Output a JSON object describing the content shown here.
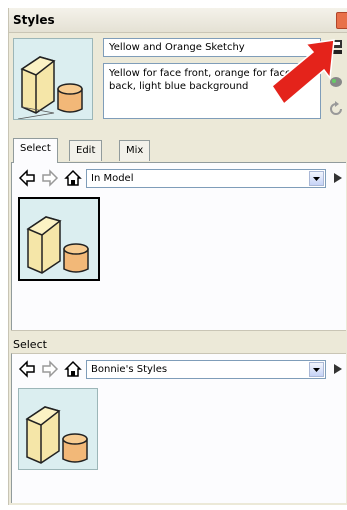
{
  "window": {
    "title": "Styles"
  },
  "current_style": {
    "name": "Yellow and Orange Sketchy",
    "description": "Yellow for face front, orange for face back, light blue background"
  },
  "tabs": [
    {
      "label": "Select",
      "active": true
    },
    {
      "label": "Edit",
      "active": false
    },
    {
      "label": "Mix",
      "active": false
    }
  ],
  "select_panel": {
    "collection": "In Model"
  },
  "secondary_panel": {
    "label": "Select",
    "collection": "Bonnie's Styles"
  },
  "colors": {
    "annotation_arrow": "#e4231b",
    "thumbnail_bg": "#dbeef0",
    "box_front": "#f5e6a8",
    "cylinder": "#f2b878"
  },
  "icons": {
    "close": "close-icon",
    "update_style": "update-style-icon",
    "paint": "paint-bucket-icon",
    "refresh": "refresh-icon",
    "back": "back-arrow-icon",
    "forward": "forward-arrow-icon",
    "home": "home-icon",
    "details": "details-arrow-icon"
  }
}
